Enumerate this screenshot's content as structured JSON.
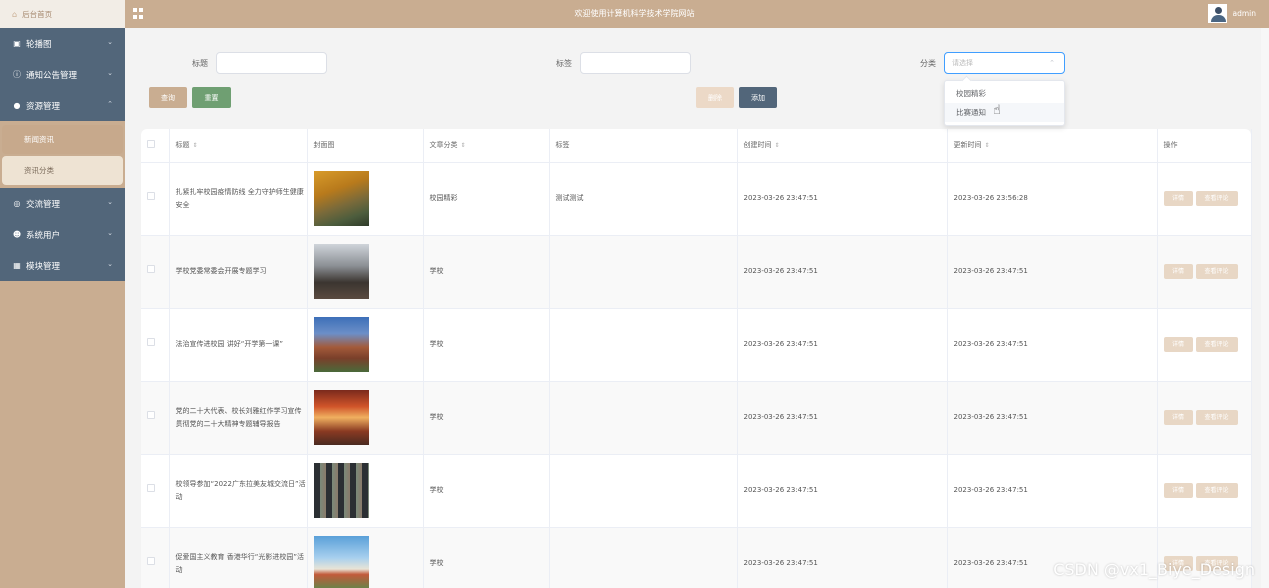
{
  "header": {
    "home_label": "后台首页",
    "site_title": "欢迎使用计算机科学技术学院网站",
    "admin_name": "admin"
  },
  "sidebar": {
    "items": [
      {
        "label": "轮播图",
        "icon": "image-icon"
      },
      {
        "label": "通知公告管理",
        "icon": "info-icon"
      },
      {
        "label": "资源管理",
        "icon": "bulb-icon",
        "expanded": true
      },
      {
        "label": "交流管理",
        "icon": "chat-icon"
      },
      {
        "label": "系统用户",
        "icon": "user-icon"
      },
      {
        "label": "模块管理",
        "icon": "grid-icon"
      }
    ],
    "sub_items": [
      {
        "label": "新闻资讯",
        "active": true
      },
      {
        "label": "资讯分类",
        "active": false
      }
    ]
  },
  "search": {
    "title_label": "标题",
    "tag_label": "标签",
    "category_label": "分类",
    "category_placeholder": "请选择",
    "query_button": "查询",
    "reset_button": "重置",
    "delete_button": "删除",
    "add_button": "添加",
    "dropdown_options": [
      "校园精彩",
      "比赛通知"
    ]
  },
  "table": {
    "headers": {
      "title": "标题",
      "cover": "封面图",
      "category": "文章分类",
      "tags": "标签",
      "created": "创建时间",
      "updated": "更新时间",
      "actions": "操作"
    },
    "detail_label": "详情",
    "comment_label": "查看评论",
    "rows": [
      {
        "title": "扎紧扎牢校园疫情防线 全力守护师生健康安全",
        "category": "校园精彩",
        "tags": "测试测试",
        "created": "2023-03-26 23:47:51",
        "updated": "2023-03-26 23:56:28",
        "thumb": "autumn-campus"
      },
      {
        "title": "学校党委常委会开展专题学习",
        "category": "学校",
        "tags": "",
        "created": "2023-03-26 23:47:51",
        "updated": "2023-03-26 23:47:51",
        "thumb": "meeting"
      },
      {
        "title": "法治宣传进校园 讲好“开学第一课”",
        "category": "学校",
        "tags": "",
        "created": "2023-03-26 23:47:51",
        "updated": "2023-03-26 23:47:51",
        "thumb": "building"
      },
      {
        "title": "党的二十大代表、校长刘雅红作学习宣传贯彻党的二十大精神专题辅导报告",
        "category": "学校",
        "tags": "",
        "created": "2023-03-26 23:47:51",
        "updated": "2023-03-26 23:47:51",
        "thumb": "stage"
      },
      {
        "title": "校领导参加“2022广东拉美友城交流日”活动",
        "category": "学校",
        "tags": "",
        "created": "2023-03-26 23:47:51",
        "updated": "2023-03-26 23:47:51",
        "thumb": "video-conference"
      },
      {
        "title": "促爱国主义教育 香港华行“光影进校园”活动",
        "category": "学校",
        "tags": "",
        "created": "2023-03-26 23:47:51",
        "updated": "2023-03-26 23:47:51",
        "thumb": "tower"
      }
    ]
  },
  "watermark": "CSDN @vx1_Biye_Design",
  "colors": {
    "accent": "#c9ad91",
    "sidebar_menu": "#52667a",
    "add_button": "#52667a",
    "reset_button": "#6f9f72",
    "select_focus": "#409eff"
  }
}
